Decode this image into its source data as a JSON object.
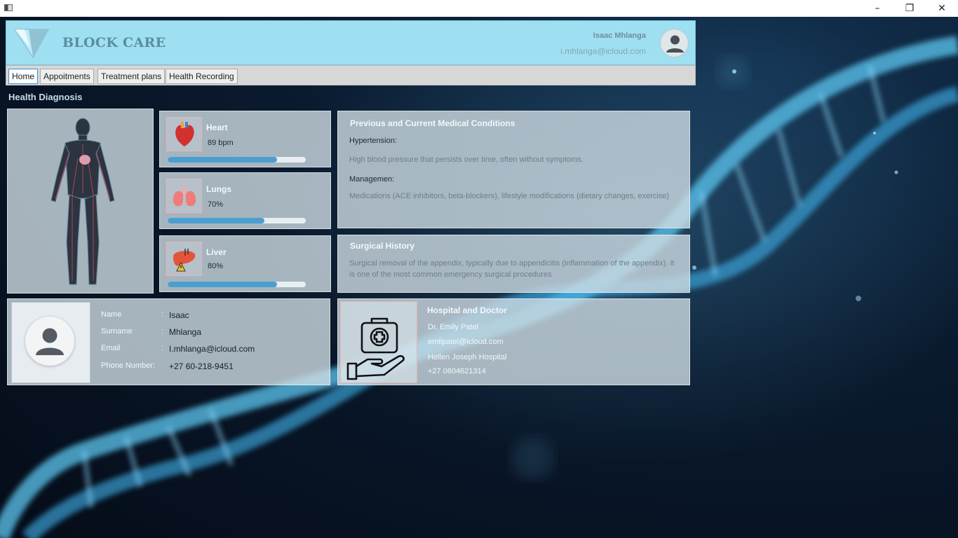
{
  "window": {
    "minimize_glyph": "–",
    "restore_glyph": "❐",
    "close_glyph": "✕"
  },
  "header": {
    "brand": "BLOCK CARE",
    "user_name": "Isaac Mhlanga",
    "user_email": "i.mhlanga@icloud.com"
  },
  "tabs": [
    {
      "label": "Home",
      "active": true
    },
    {
      "label": "Appoitments",
      "active": false
    },
    {
      "label": "Treatment plans",
      "active": false
    },
    {
      "label": "Health Recording",
      "active": false
    }
  ],
  "section_title": "Health Diagnosis",
  "organs": [
    {
      "name": "Heart",
      "value": "89 bpm",
      "level": 0.79,
      "icon": "heart-icon"
    },
    {
      "name": "Lungs",
      "value": "70%",
      "level": 0.7,
      "icon": "lungs-icon"
    },
    {
      "name": "Liver",
      "value": "80%",
      "level": 0.79,
      "icon": "liver-icon"
    }
  ],
  "conditions": {
    "title": "Previous and Current Medical Conditions",
    "condition_label": "Hypertension:",
    "condition_text": "High blood pressure that persists over time, often without symptoms.",
    "management_label": "Managemen:",
    "management_text": "Medications (ACE inhibitors, beta-blockers), lifestyle modifications (dietary changes, exercise)"
  },
  "surgical": {
    "title": "Surgical History",
    "text": "Surgical removal of the appendix, typically due to appendicitis (inflammation of the appendix). It is one of the most common emergency surgical procedures"
  },
  "profile": {
    "name_label": "Name",
    "name": "Isaac",
    "surname_label": "Surname",
    "surname": "Mhlanga",
    "email_label": "Email",
    "email": "I.mhlanga@icloud.com",
    "phone_label": "Phone Number:",
    "phone": "+27 60-218-9451",
    "colon": ":"
  },
  "hospital": {
    "title": "Hospital and Doctor",
    "doctor": "Dr. Emily Patel",
    "email": "emilpatel@icloud.com",
    "hospital": "Hellen Joseph Hospital",
    "phone": "+27 0604621314"
  },
  "colors": {
    "header_bg": "#9fdff2",
    "accent_bar": "#4b9fd0",
    "brand_text": "#5a8ea0"
  }
}
